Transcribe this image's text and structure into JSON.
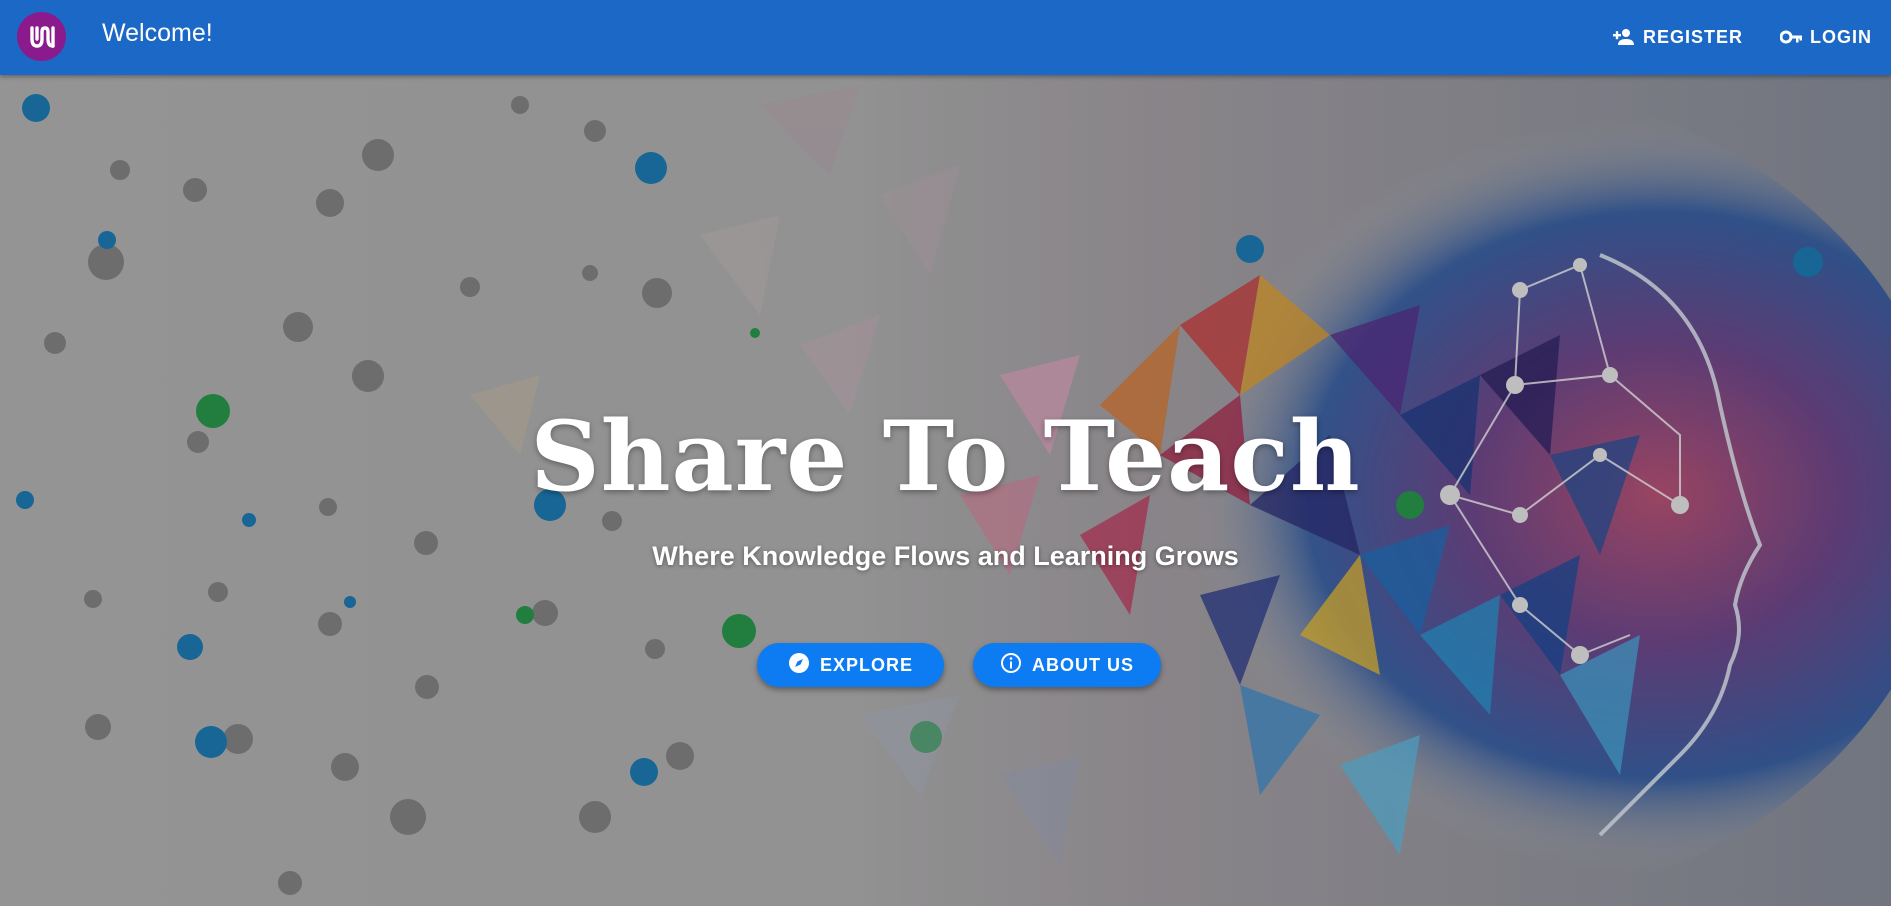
{
  "header": {
    "brand": "Welcome!",
    "logo_icon": "share-to-teach-logo",
    "register_label": "REGISTER",
    "login_label": "LOGIN"
  },
  "hero": {
    "title": "Share To Teach",
    "subtitle": "Where Knowledge Flows and Learning Grows",
    "explore_label": "EXPLORE",
    "about_label": "ABOUT US"
  },
  "colors": {
    "appbar": "#1b68c6",
    "logo": "#8b1a8c",
    "button": "#0d7bf2"
  }
}
